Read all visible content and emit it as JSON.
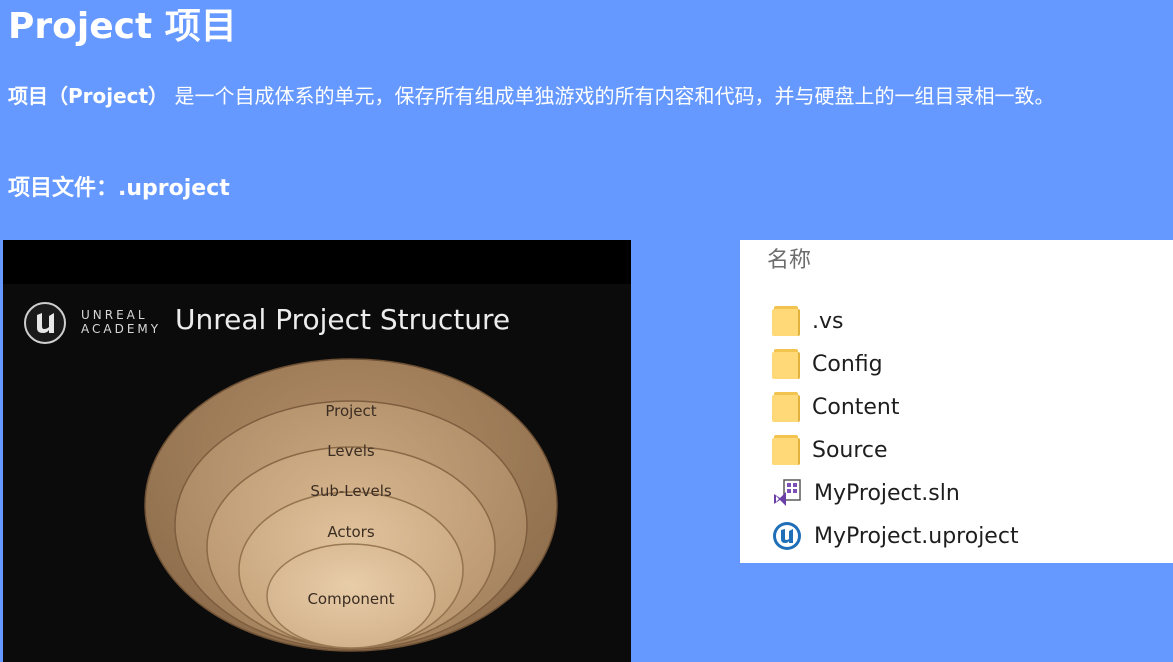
{
  "header": {
    "title": "Project 项目",
    "description_bold": "项目（Project）",
    "description_rest": " 是一个自成体系的单元，保存所有组成单独游戏的所有内容和代码，并与硬盘上的一组目录相一致。",
    "file_line": "项目文件：.uproject"
  },
  "diagram": {
    "logo_line1": "UNREAL",
    "logo_line2": "ACADEMY",
    "heading": "Unreal Project Structure",
    "layers": [
      "Project",
      "Levels",
      "Sub-Levels",
      "Actors",
      "Component"
    ],
    "colors": {
      "background": "#0b0b0b",
      "layer_light": "#d9bb94",
      "layer_dark": "#b8946a"
    }
  },
  "explorer": {
    "column_header": "名称",
    "files": [
      {
        "name": ".vs",
        "icon": "folder-icon"
      },
      {
        "name": "Config",
        "icon": "folder-icon"
      },
      {
        "name": "Content",
        "icon": "folder-icon"
      },
      {
        "name": "Source",
        "icon": "folder-icon"
      },
      {
        "name": "MyProject.sln",
        "icon": "visual-studio-solution-icon"
      },
      {
        "name": "MyProject.uproject",
        "icon": "unreal-project-icon"
      }
    ]
  },
  "colors": {
    "slide_background": "#6699ff",
    "text": "#ffffff"
  }
}
